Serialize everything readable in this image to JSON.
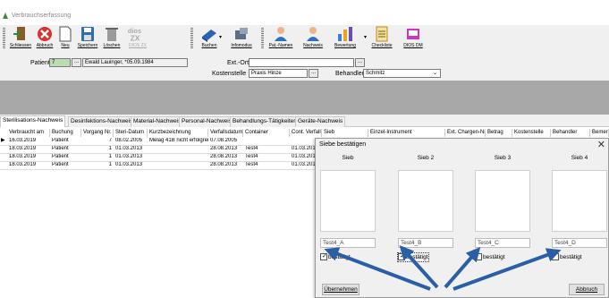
{
  "window": {
    "title": "Verbrauchserfassung"
  },
  "toolbar": {
    "buttons": [
      {
        "label": "Schliessen",
        "icon": "exit-door-icon"
      },
      {
        "label": "Abbruch",
        "icon": "cancel-x-icon"
      },
      {
        "label": "Neu",
        "icon": "new-document-icon"
      },
      {
        "label": "Speichern",
        "icon": "save-floppy-icon"
      },
      {
        "label": "Löschen",
        "icon": "delete-trash-icon"
      },
      {
        "label": "DIOS ZX",
        "icon": "dios-zx-logo-icon"
      },
      {
        "label": "Buchen",
        "icon": "book-icon"
      },
      {
        "label": "Infomodus",
        "icon": "info-mode-icon"
      },
      {
        "label": "Pat.-Namen",
        "icon": "patient-names-icon"
      },
      {
        "label": "Nachweis",
        "icon": "proof-person-icon"
      },
      {
        "label": "Bewertung",
        "icon": "rating-chart-icon"
      },
      {
        "label": "Checkliste",
        "icon": "checklist-icon"
      },
      {
        "label": "DIOS DM",
        "icon": "dios-dm-logo-icon"
      }
    ],
    "logo_zx": "dios\nZX"
  },
  "patient_panel": {
    "patient_label": "Patient",
    "patient_id": "7",
    "patient_name": "Ewald Lauinger, *05.09.1984",
    "ext_ort_label": "Ext.-Ort",
    "ext_ort_value": "",
    "kostenstelle_label": "Kostenstelle",
    "kostenstelle_value": "Praxis Hinze",
    "behandler_label": "Behandler",
    "behandler_value": "Schmitz",
    "dots": "..."
  },
  "tabs": [
    {
      "label": "Sterilisations-Nachweis",
      "active": true
    },
    {
      "label": "Desinfektions-Nachweis",
      "active": false
    },
    {
      "label": "Material-Nachweis",
      "active": false
    },
    {
      "label": "Personal-Nachweis",
      "active": false
    },
    {
      "label": "Behandlungs-Tätigkeiten",
      "active": false
    },
    {
      "label": "Geräte-Nachweis",
      "active": false
    }
  ],
  "grid": {
    "columns": [
      "Verbraucht am",
      "Buchung",
      "Vorgang Nr.",
      "Steri-Datum",
      "Kurzbezeichnung",
      "Verfallsdatum",
      "Container",
      "Cont. Verfall",
      "Sieb",
      "Einzel-Instrument",
      "Ext. Chargen-Nr.",
      "Betrag",
      "Kostenstelle",
      "Behandler",
      "Bemerk"
    ],
    "rows": [
      [
        "16.03.2019",
        "Patient",
        "7",
        "08.02.2005",
        "Melag 41B nicht erfolgreich",
        "07.08.2005",
        "",
        ""
      ],
      [
        "18.03.2019",
        "Patient",
        "1",
        "01.03.2013",
        "",
        "28.08.2013",
        "Test4",
        "01.03.2015"
      ],
      [
        "18.03.2019",
        "Patient",
        "1",
        "01.03.2013",
        "",
        "28.08.2013",
        "Test4",
        "01.03.2015"
      ],
      [
        "18.03.2019",
        "Patient",
        "1",
        "01.03.2013",
        "",
        "28.08.2013",
        "Test4",
        "01.03.2015"
      ]
    ],
    "row_indicator": "▶"
  },
  "dialog": {
    "title": "Siebe bestätigen",
    "close": "✕",
    "sieb_header": "Sieb",
    "siebe": [
      {
        "header": "Sieb",
        "value": "Test4_A",
        "check_label": "bestätigt",
        "checked": true
      },
      {
        "header": "Sieb 2",
        "value": "Test4_B",
        "check_label": "bestätigt",
        "checked": true
      },
      {
        "header": "Sieb 3",
        "value": "Test4_C",
        "check_label": "bestätigt",
        "checked": false
      },
      {
        "header": "Sieb 4",
        "value": "Test4_D",
        "check_label": "bestätigt",
        "checked": false
      }
    ],
    "ok_label": "Übernehmen",
    "cancel_label": "Abbruch",
    "check_mark": "✓"
  },
  "colors": {
    "arrow": "#2a5fa8",
    "grey_band": "#a8a8a8",
    "window_bg": "#f0f0f0"
  }
}
